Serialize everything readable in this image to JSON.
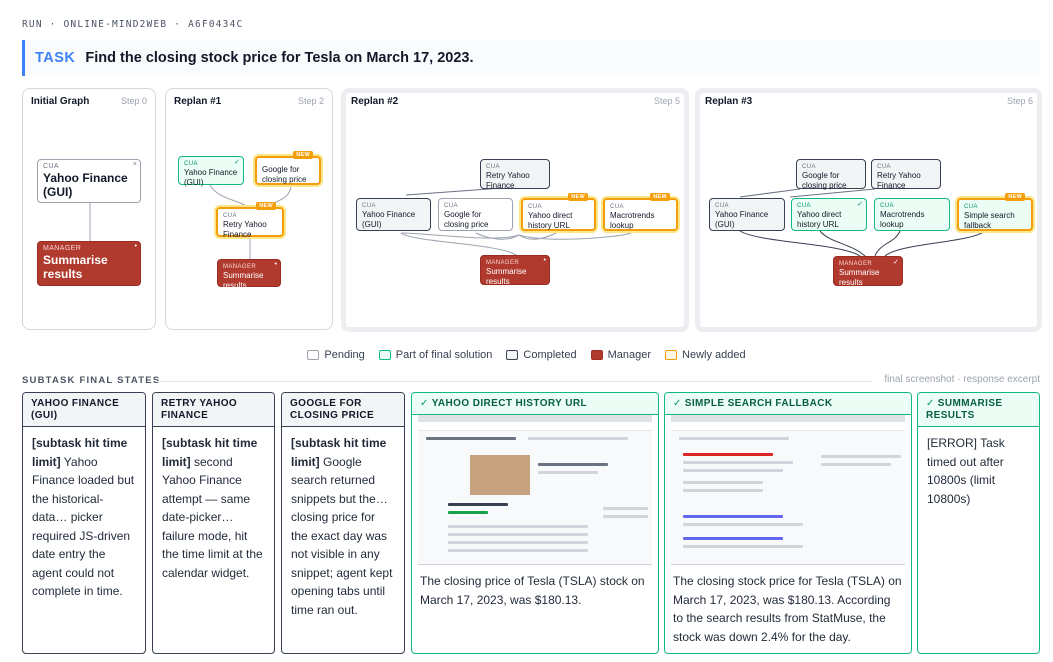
{
  "run": {
    "id": "RUN · ONLINE-MIND2WEB · A6F0434C"
  },
  "task": {
    "tag": "TASK",
    "text": "Find the closing stock price for Tesla on March 17, 2023."
  },
  "panels": {
    "p0": {
      "title": "Initial Graph",
      "step": "Step 0"
    },
    "p1": {
      "title": "Replan #1",
      "step": "Step 2"
    },
    "p2": {
      "title": "Replan #2",
      "step": "Step 5"
    },
    "p3": {
      "title": "Replan #3",
      "step": "Step 6"
    }
  },
  "node_types": {
    "cua": "CUA",
    "manager": "MANAGER"
  },
  "new_badge": "NEW",
  "nodes": {
    "yahoo_gui": "Yahoo Finance (GUI)",
    "yahoo_short": "Yahoo Finance (GUI)",
    "summarise": "Summarise results",
    "google": "Google for closing price",
    "retry": "Retry Yahoo Finance",
    "direct": "Yahoo direct history URL",
    "macro": "Macrotrends lookup",
    "simple": "Simple search fallback"
  },
  "legend": {
    "pending": "Pending",
    "final": "Part of final solution",
    "completed": "Completed",
    "manager": "Manager",
    "new": "Newly added"
  },
  "subtasks": {
    "section_title": "SUBTASK FINAL STATES",
    "note": "final screenshot · response excerpt",
    "cards": [
      {
        "title": "YAHOO FINANCE (GUI)",
        "lead": "[subtask hit time limit]",
        "text": " Yahoo Finance loaded but the historical-data… picker required JS-driven date entry the agent could not complete in time."
      },
      {
        "title": "RETRY YAHOO FINANCE",
        "lead": "[subtask hit time limit]",
        "text": " second Yahoo Finance attempt — same date-picker… failure mode, hit the time limit at the calendar widget."
      },
      {
        "title": "GOOGLE FOR CLOSING PRICE",
        "lead": "[subtask hit time limit]",
        "text": " Google search returned snippets but the… closing price for the exact day was not visible in any snippet; agent kept opening tabs until time ran out."
      },
      {
        "title": "YAHOO DIRECT HISTORY URL",
        "text": "The closing price of Tesla (TSLA) stock on March 17, 2023, was $180.13."
      },
      {
        "title": "SIMPLE SEARCH FALLBACK",
        "text": "The closing stock price for Tesla (TSLA) on March 17, 2023, was $180.13. According to the search results from StatMuse, the stock was down 2.4% for the day."
      },
      {
        "title": "SUMMARISE RESULTS",
        "text": "[ERROR] Task timed out after 10800s (limit 10800s)"
      }
    ]
  },
  "colors": {
    "accent": "#3b82f6",
    "final": "#10b981",
    "manager": "#b03a2e",
    "new": "#f59e0b",
    "completed": "#374151"
  },
  "icons": {
    "check": "check-icon",
    "close": "close-icon"
  }
}
